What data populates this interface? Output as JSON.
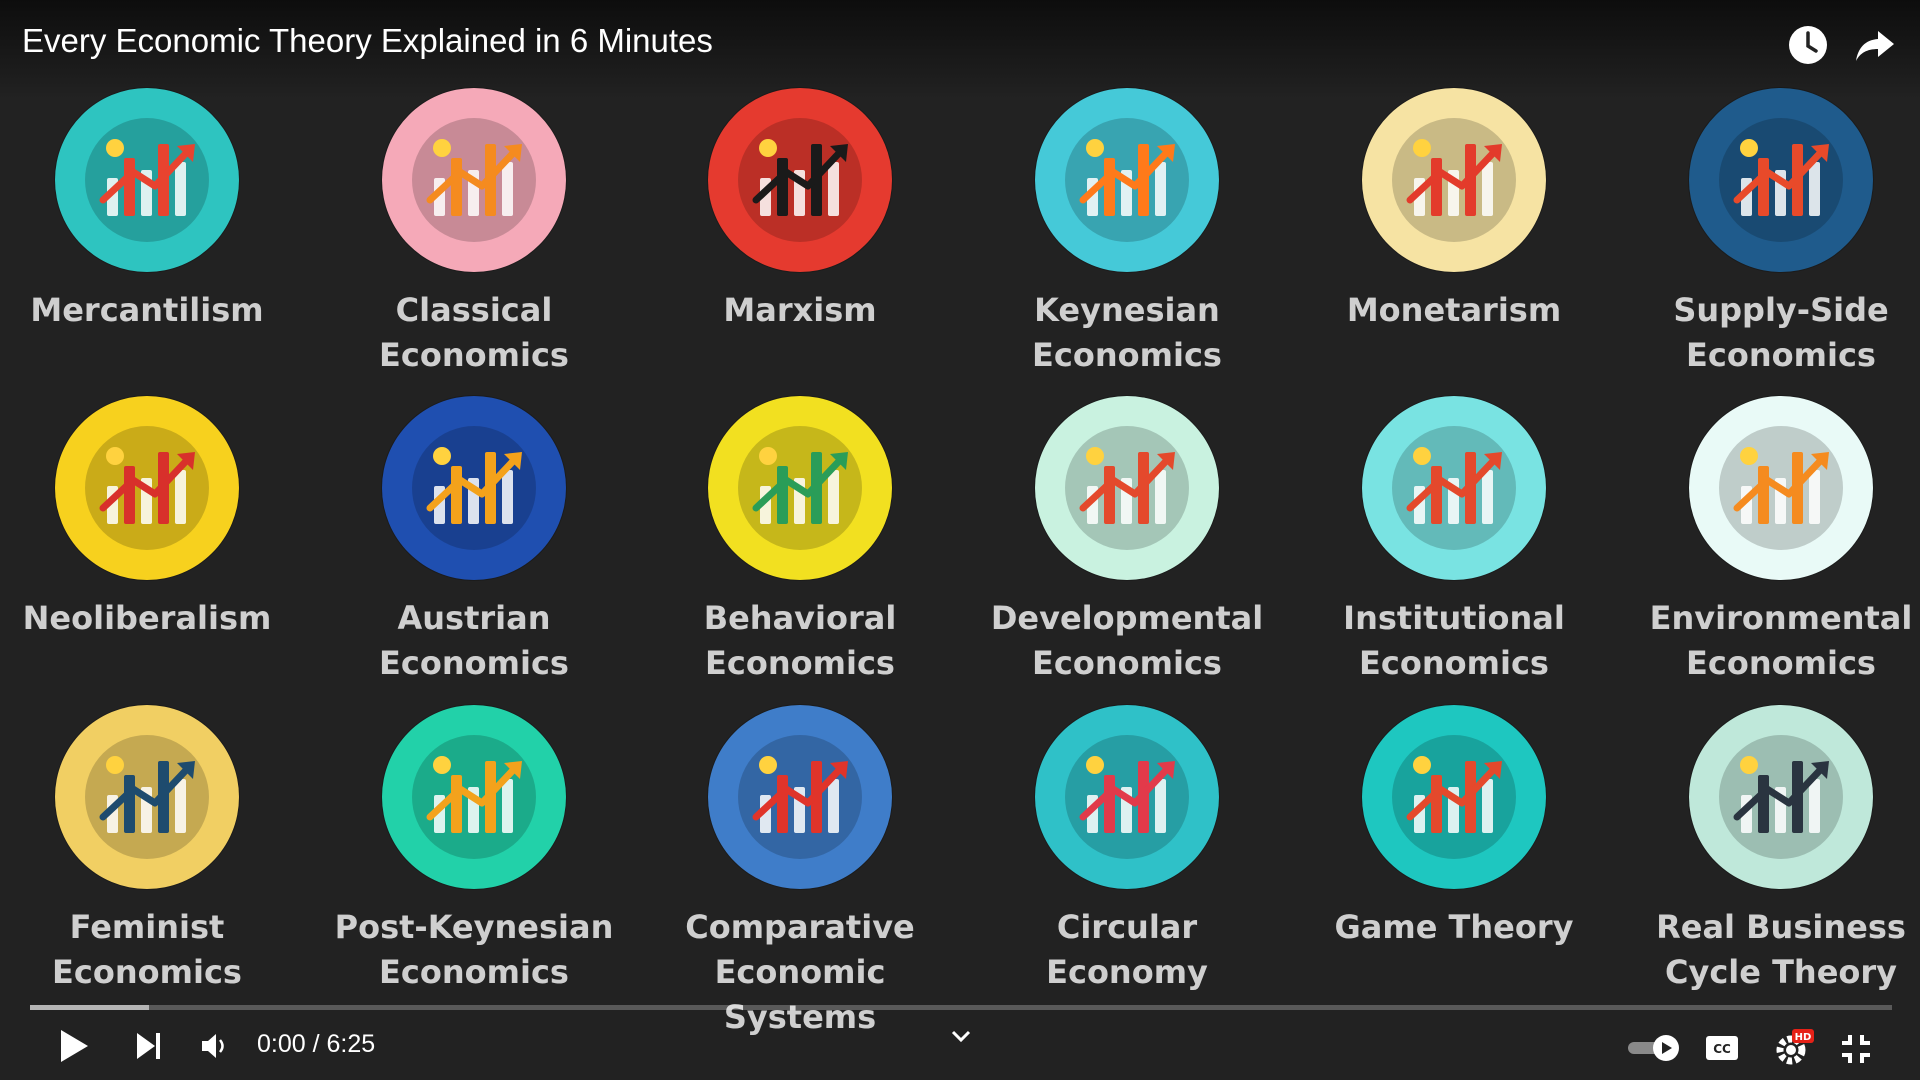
{
  "video": {
    "title": "Every Economic Theory Explained in 6 Minutes",
    "current_time": "0:00",
    "separator": " / ",
    "duration": "6:25",
    "progress_fraction": 0.0,
    "buffered_fraction": 0.064
  },
  "icons": {
    "watch_later": "clock-icon",
    "share": "share-icon",
    "play": "play-icon",
    "next": "next-icon",
    "volume": "volume-icon",
    "chapters": "chevron-down-icon",
    "autoplay": "autoplay-toggle-icon",
    "captions": "cc-icon",
    "settings": "gear-icon",
    "quality_badge": "HD",
    "fullscreen": "exit-fullscreen-icon"
  },
  "tiles": [
    {
      "lines": [
        "Mercantilism"
      ],
      "bg": "#2ec4c0",
      "accent": "#e8432f"
    },
    {
      "lines": [
        "Classical",
        "Economics"
      ],
      "bg": "#f5a9b8",
      "accent": "#f58b1f"
    },
    {
      "lines": [
        "Marxism"
      ],
      "bg": "#e53a2f",
      "accent": "#1a1a1a"
    },
    {
      "lines": [
        "Keynesian",
        "Economics"
      ],
      "bg": "#45c9d8",
      "accent": "#ff7a1a"
    },
    {
      "lines": [
        "Monetarism"
      ],
      "bg": "#f6e3a3",
      "accent": "#e33b2b"
    },
    {
      "lines": [
        "Supply-Side",
        "Economics"
      ],
      "bg": "#1f5b8c",
      "accent": "#e84a2a"
    },
    {
      "lines": [
        "Neoliberalism"
      ],
      "bg": "#f7d11e",
      "accent": "#d8302b"
    },
    {
      "lines": [
        "Austrian",
        "Economics"
      ],
      "bg": "#1f4fb0",
      "accent": "#f4a21b"
    },
    {
      "lines": [
        "Behavioral",
        "Economics"
      ],
      "bg": "#f2e020",
      "accent": "#2a9d58"
    },
    {
      "lines": [
        "Developmental",
        "Economics"
      ],
      "bg": "#c9f2e0",
      "accent": "#e4492c"
    },
    {
      "lines": [
        "Institutional",
        "Economics"
      ],
      "bg": "#79e3e2",
      "accent": "#e4492c"
    },
    {
      "lines": [
        "Environmental",
        "Economics"
      ],
      "bg": "#e9faf7",
      "accent": "#f58b1f"
    },
    {
      "lines": [
        "Feminist",
        "Economics"
      ],
      "bg": "#f1cf63",
      "accent": "#1e4b6e"
    },
    {
      "lines": [
        "Post-Keynesian",
        "Economics"
      ],
      "bg": "#22d1a9",
      "accent": "#f3a21c"
    },
    {
      "lines": [
        "Comparative",
        "Economic Systems"
      ],
      "bg": "#3f7dc9",
      "accent": "#e0342a"
    },
    {
      "lines": [
        "Circular",
        "Economy"
      ],
      "bg": "#2fc1c8",
      "accent": "#e23a4a"
    },
    {
      "lines": [
        "Game Theory"
      ],
      "bg": "#1ec7c0",
      "accent": "#e4492c"
    },
    {
      "lines": [
        "Real Business",
        "Cycle Theory"
      ],
      "bg": "#bfe8da",
      "accent": "#2a3440"
    }
  ]
}
